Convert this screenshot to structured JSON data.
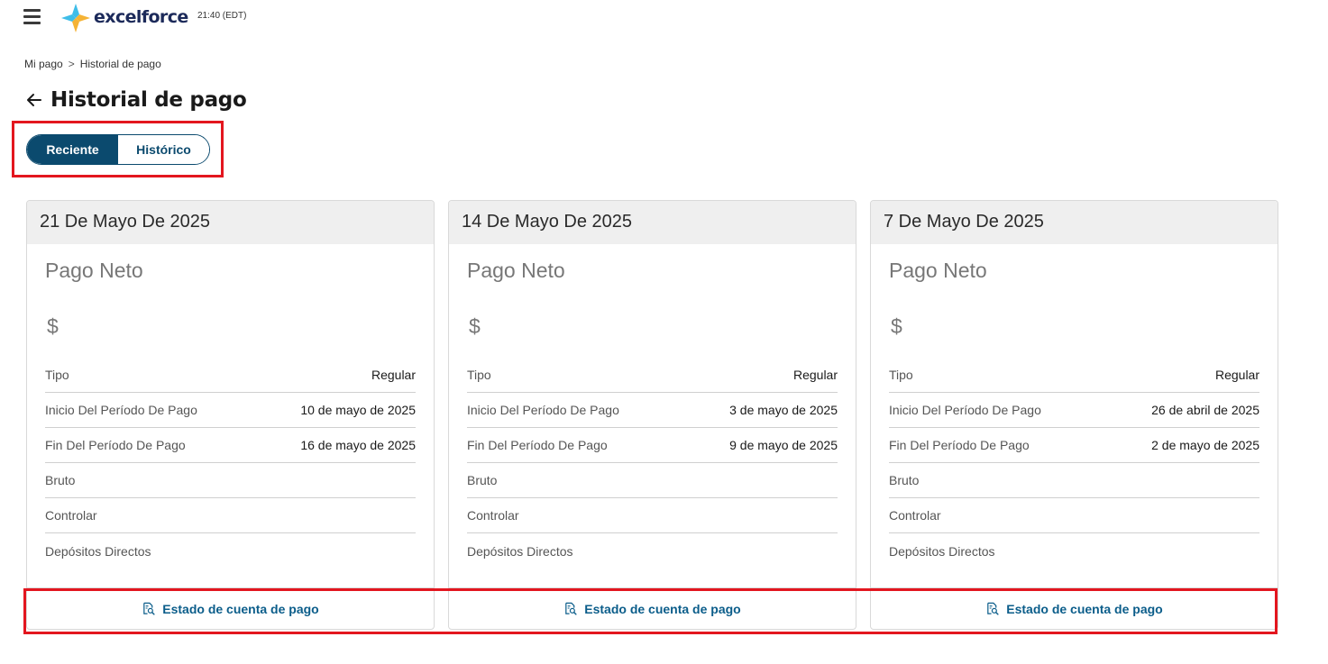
{
  "header": {
    "logo_text": "excelforce",
    "clock": "21:40 (EDT)"
  },
  "breadcrumb": {
    "items": [
      "Mi pago",
      "Historial de pago"
    ],
    "separator": ">"
  },
  "page": {
    "title": "Historial de pago"
  },
  "toggle": {
    "recent_label": "Reciente",
    "historic_label": "Histórico",
    "active": "Reciente"
  },
  "labels": {
    "net_pay": "Pago Neto",
    "currency": "$",
    "type": "Tipo",
    "period_start": "Inicio Del Período De Pago",
    "period_end": "Fin Del Período De Pago",
    "gross": "Bruto",
    "check": "Controlar",
    "direct_deposits": "Depósitos Directos",
    "statement_link": "Estado de cuenta de pago"
  },
  "cards": [
    {
      "date": "21 De Mayo De 2025",
      "type": "Regular",
      "period_start": "10 de mayo de 2025",
      "period_end": "16 de mayo de 2025"
    },
    {
      "date": "14 De Mayo De 2025",
      "type": "Regular",
      "period_start": "3 de mayo de 2025",
      "period_end": "9 de mayo de 2025"
    },
    {
      "date": "7 De Mayo De 2025",
      "type": "Regular",
      "period_start": "26 de abril de 2025",
      "period_end": "2 de mayo de 2025"
    }
  ],
  "colors": {
    "accent": "#0b4a6e",
    "link": "#0b5d8a",
    "highlight": "#e3161f"
  }
}
